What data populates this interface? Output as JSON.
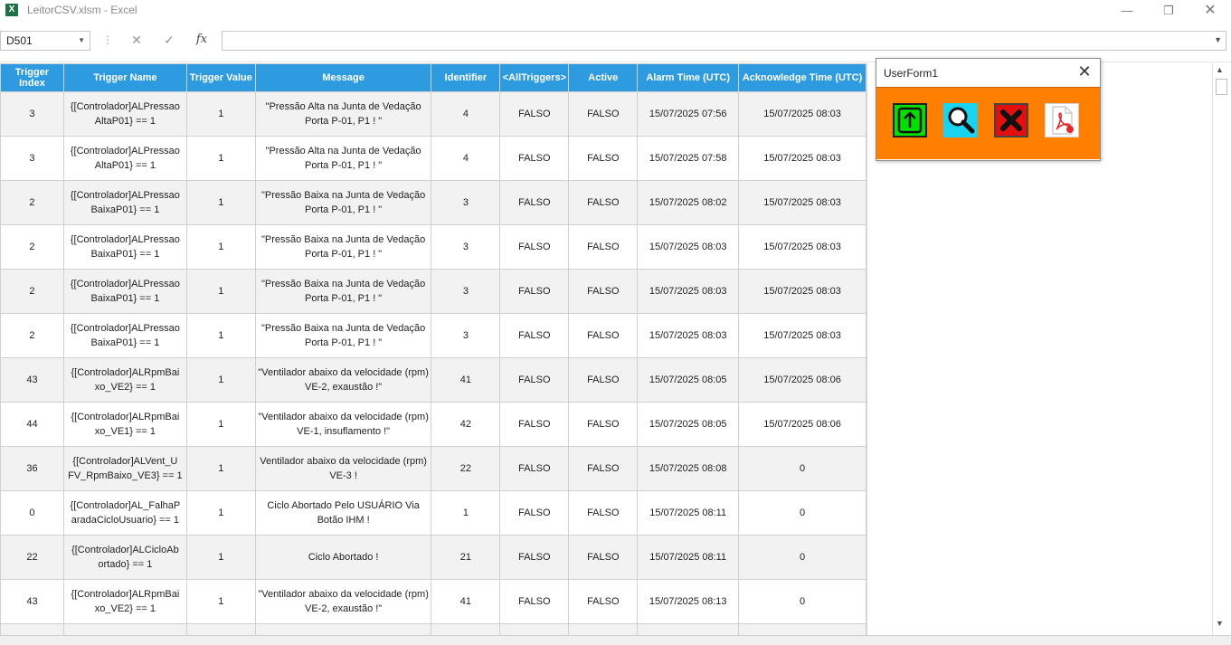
{
  "window": {
    "title": "LeitorCSV.xlsm  -  Excel",
    "logo_letter": "X",
    "minimize": "—",
    "maximize": "❐",
    "close": "✕"
  },
  "formula_bar": {
    "name_box": "D501",
    "cancel_icon": "✕",
    "enter_icon": "✓",
    "fx_label": "fx",
    "formula": ""
  },
  "table": {
    "headers": [
      "Trigger Index",
      "Trigger Name",
      "Trigger Value",
      "Message",
      "Identifier",
      "<AllTriggers>",
      "Active",
      "Alarm Time (UTC)",
      "Acknowledge Time (UTC)"
    ],
    "rows": [
      [
        "3",
        "{[Controlador]ALPressao AltaP01} == 1",
        "1",
        "\"Pressão Alta na Junta de Vedação Porta P-01, P1 ! \"",
        "4",
        "FALSO",
        "FALSO",
        "15/07/2025 07:56",
        "15/07/2025 08:03"
      ],
      [
        "3",
        "{[Controlador]ALPressao AltaP01} == 1",
        "1",
        "\"Pressão Alta na Junta de Vedação Porta P-01, P1 ! \"",
        "4",
        "FALSO",
        "FALSO",
        "15/07/2025 07:58",
        "15/07/2025 08:03"
      ],
      [
        "2",
        "{[Controlador]ALPressao BaixaP01} == 1",
        "1",
        "\"Pressão Baixa na Junta de Vedação Porta P-01, P1 ! \"",
        "3",
        "FALSO",
        "FALSO",
        "15/07/2025 08:02",
        "15/07/2025 08:03"
      ],
      [
        "2",
        "{[Controlador]ALPressao BaixaP01} == 1",
        "1",
        "\"Pressão Baixa na Junta de Vedação Porta P-01, P1 ! \"",
        "3",
        "FALSO",
        "FALSO",
        "15/07/2025 08:03",
        "15/07/2025 08:03"
      ],
      [
        "2",
        "{[Controlador]ALPressao BaixaP01} == 1",
        "1",
        "\"Pressão Baixa na Junta de Vedação Porta P-01, P1 ! \"",
        "3",
        "FALSO",
        "FALSO",
        "15/07/2025 08:03",
        "15/07/2025 08:03"
      ],
      [
        "2",
        "{[Controlador]ALPressao BaixaP01} == 1",
        "1",
        "\"Pressão Baixa na Junta de Vedação Porta P-01, P1 ! \"",
        "3",
        "FALSO",
        "FALSO",
        "15/07/2025 08:03",
        "15/07/2025 08:03"
      ],
      [
        "43",
        "{[Controlador]ALRpmBai xo_VE2} == 1",
        "1",
        "\"Ventilador abaixo da velocidade (rpm) VE-2, exaustão !\"",
        "41",
        "FALSO",
        "FALSO",
        "15/07/2025 08:05",
        "15/07/2025 08:06"
      ],
      [
        "44",
        "{[Controlador]ALRpmBai xo_VE1} == 1",
        "1",
        "\"Ventilador abaixo da velocidade (rpm) VE-1, insuflamento !\"",
        "42",
        "FALSO",
        "FALSO",
        "15/07/2025 08:05",
        "15/07/2025 08:06"
      ],
      [
        "36",
        "{[Controlador]ALVent_U FV_RpmBaixo_VE3} == 1",
        "1",
        "Ventilador abaixo da velocidade (rpm) VE-3 !",
        "22",
        "FALSO",
        "FALSO",
        "15/07/2025 08:08",
        "0"
      ],
      [
        "0",
        "{[Controlador]AL_FalhaP aradaCicloUsuario} == 1",
        "1",
        "Ciclo Abortado Pelo USUÁRIO Via Botão IHM !",
        "1",
        "FALSO",
        "FALSO",
        "15/07/2025 08:11",
        "0"
      ],
      [
        "22",
        "{[Controlador]ALCicloAb ortado} == 1",
        "1",
        "Ciclo Abortado !",
        "21",
        "FALSO",
        "FALSO",
        "15/07/2025 08:11",
        "0"
      ],
      [
        "43",
        "{[Controlador]ALRpmBai xo_VE2} == 1",
        "1",
        "\"Ventilador abaixo da velocidade (rpm) VE-2, exaustão !\"",
        "41",
        "FALSO",
        "FALSO",
        "15/07/2025 08:13",
        "0"
      ]
    ]
  },
  "userform": {
    "title": "UserForm1",
    "close_icon": "✕",
    "buttons": [
      {
        "name": "upload-icon",
        "color": "#00e000"
      },
      {
        "name": "search-icon",
        "color": "#18d4f0"
      },
      {
        "name": "delete-icon",
        "color": "#e01010"
      },
      {
        "name": "pdf-icon",
        "color": "#ffffff"
      }
    ],
    "background": "#ff8000"
  },
  "colors": {
    "header_bg": "#2e9be0",
    "odd_row": "#f2f2f2",
    "excel_green": "#1e7145"
  }
}
